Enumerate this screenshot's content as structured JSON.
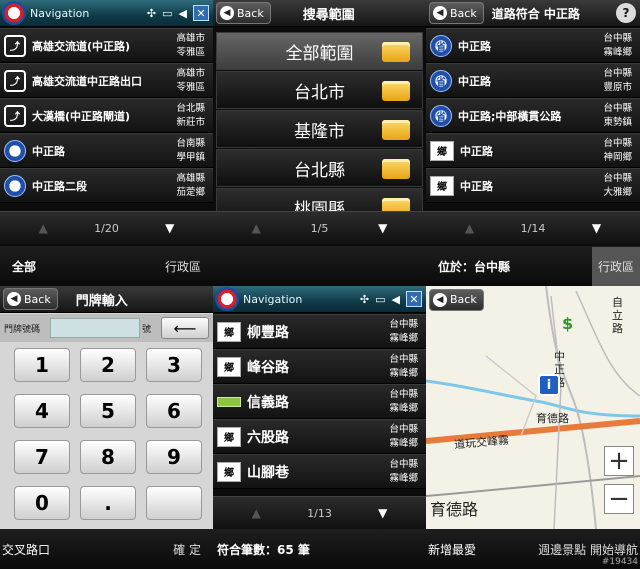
{
  "panels": {
    "nav_list": {
      "title": "Navigation",
      "items": [
        {
          "icon": "junction-icon",
          "name": "高雄交流道(中正路)",
          "city": "高雄市",
          "district": "苓雅區"
        },
        {
          "icon": "junction-icon",
          "name": "高雄交流道中正路出口",
          "city": "高雄市",
          "district": "苓雅區"
        },
        {
          "icon": "junction-icon",
          "name": "大漢橋(中正路閘道)",
          "city": "台北縣",
          "district": "新莊市"
        },
        {
          "icon": "shield-icon",
          "name": "中正路",
          "city": "台南縣",
          "district": "學甲鎮"
        },
        {
          "icon": "shield-icon",
          "name": "中正路二段",
          "city": "高雄縣",
          "district": "茄萣鄉"
        }
      ],
      "page": "1/20",
      "status_left": "全部",
      "status_right": "行政區"
    },
    "scope": {
      "back": "Back",
      "title": "搜尋範圍",
      "items": [
        "全部範圍",
        "台北市",
        "基隆市",
        "台北縣",
        "桃園縣"
      ],
      "page": "1/5"
    },
    "road_match": {
      "back": "Back",
      "title": "道路符合 中正路",
      "help": "?",
      "items": [
        {
          "icon": "shield-icon",
          "badge": "省",
          "name": "中正路",
          "city": "台中縣",
          "district": "霧峰鄉"
        },
        {
          "icon": "shield-icon",
          "badge": "省",
          "name": "中正路",
          "city": "台中縣",
          "district": "豐原市"
        },
        {
          "icon": "shield-icon",
          "badge": "省",
          "name": "中正路;中部橫貫公路",
          "city": "台中縣",
          "district": "東勢鎮"
        },
        {
          "icon": "township-icon",
          "badge": "鄉",
          "name": "中正路",
          "city": "台中縣",
          "district": "神岡鄉"
        },
        {
          "icon": "township-icon",
          "badge": "鄉",
          "name": "中正路",
          "city": "台中縣",
          "district": "大雅鄉"
        }
      ],
      "page": "1/14",
      "status_left": "位於：台中縣",
      "status_right": "行政區"
    },
    "keypad": {
      "back": "Back",
      "title": "門牌輸入",
      "input_label": "門牌號碼",
      "input_unit": "號",
      "keys": [
        "1",
        "2",
        "3",
        "4",
        "5",
        "6",
        "7",
        "8",
        "9",
        "0",
        ".",
        ""
      ],
      "status_left": "交叉路口",
      "status_right": "確 定"
    },
    "nav_list2": {
      "title": "Navigation",
      "items": [
        {
          "icon": "township-icon",
          "badge": "鄉",
          "name": "柳豐路",
          "city": "台中縣",
          "district": "霧峰鄉"
        },
        {
          "icon": "township-icon",
          "badge": "鄉",
          "name": "峰谷路",
          "city": "台中縣",
          "district": "霧峰鄉"
        },
        {
          "icon": "green-road-icon",
          "badge": "",
          "name": "信義路",
          "city": "台中縣",
          "district": "霧峰鄉"
        },
        {
          "icon": "township-icon",
          "badge": "鄉",
          "name": "六股路",
          "city": "台中縣",
          "district": "霧峰鄉"
        },
        {
          "icon": "township-icon",
          "badge": "鄉",
          "name": "山腳巷",
          "city": "台中縣",
          "district": "霧峰鄉"
        }
      ],
      "page": "1/13",
      "status_left": "符合筆數：65 筆"
    },
    "map": {
      "back": "Back",
      "labels": [
        "自立路",
        "中正路",
        "育德路",
        "道玩交峰霧",
        "育德路"
      ],
      "zoom_in": "+",
      "zoom_out": "−",
      "status_left": "新增最愛",
      "status_right": "週邊景點 開始導航",
      "watermark": "#19434"
    }
  },
  "colors": {
    "nav_titlebar": "#0f3a48",
    "shield_blue": "#1f4fa8",
    "folder_yellow": "#ffd86a",
    "map_background": "#f4f1e7",
    "road_orange": "#e87a3a",
    "water_blue": "#7fc7e8"
  }
}
